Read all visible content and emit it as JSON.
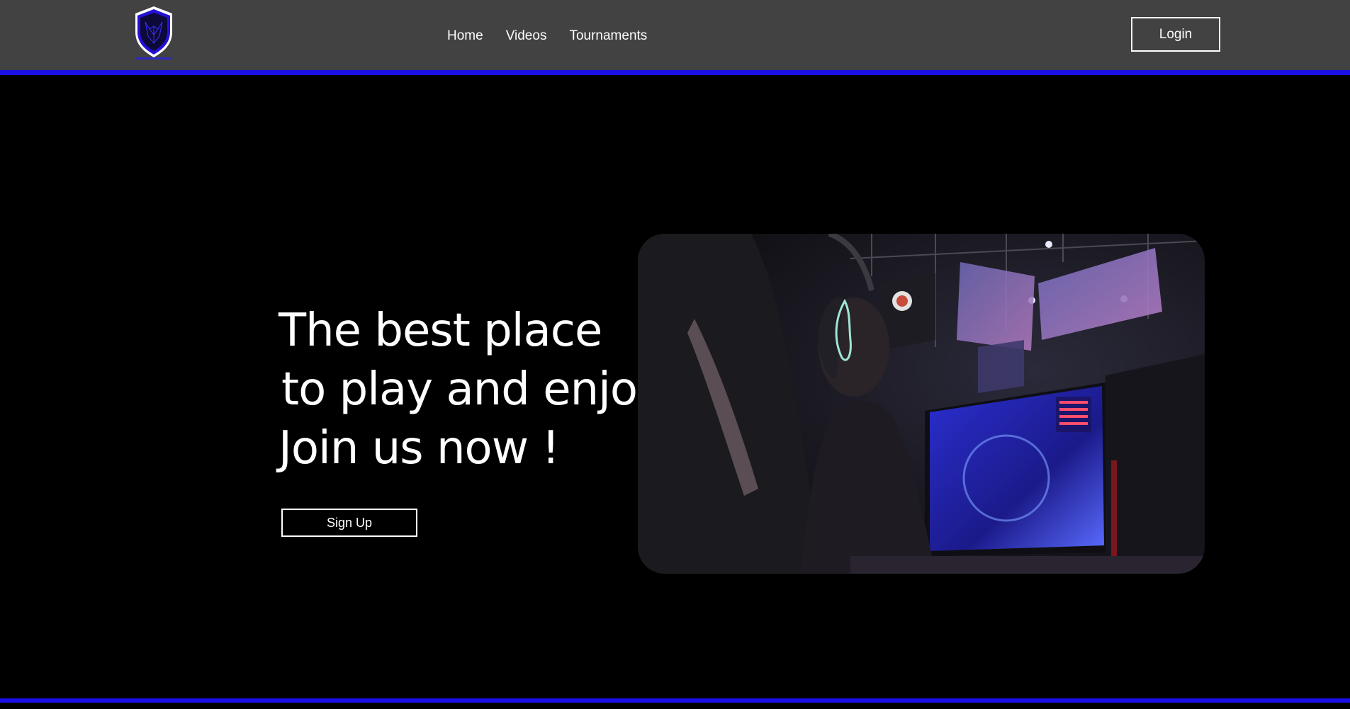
{
  "header": {
    "logo_icon": "shield-wolf-icon",
    "nav": [
      "Home",
      "Videos",
      "Tournaments"
    ],
    "login_label": "Login"
  },
  "hero": {
    "title_lines": [
      "The best place",
      "to play and enjoy",
      "Join us now !"
    ],
    "signup_label": "Sign Up",
    "image_icon": "gamer-esports-photo"
  },
  "colors": {
    "header_bg": "#424242",
    "accent": "#1a10e6",
    "page_bg": "#000000",
    "text": "#ffffff"
  }
}
